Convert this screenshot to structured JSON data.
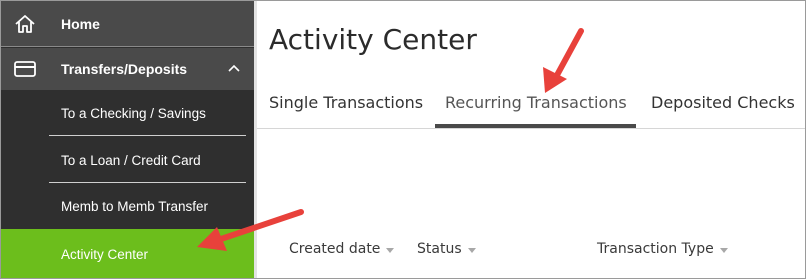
{
  "sidebar": {
    "home": {
      "label": "Home",
      "icon": "home-icon"
    },
    "transfers": {
      "label": "Transfers/Deposits",
      "icon": "card-icon",
      "expand_icon": "chevron-up-icon"
    },
    "sub_items": [
      {
        "label": "To a Checking / Savings"
      },
      {
        "label": "To a Loan / Credit Card"
      },
      {
        "label": "Memb to Memb Transfer"
      },
      {
        "label": "Activity Center",
        "active": true
      }
    ]
  },
  "main": {
    "title": "Activity Center",
    "tabs": [
      {
        "label": "Single Transactions"
      },
      {
        "label": "Recurring Transactions",
        "selected": true
      },
      {
        "label": "Deposited Checks"
      }
    ],
    "columns": [
      {
        "label": "Created date"
      },
      {
        "label": "Status"
      },
      {
        "label": "Transaction Type"
      }
    ]
  },
  "colors": {
    "sidebar_bg": "#2f2f2f",
    "active_item": "#6cbe1c",
    "annotation_arrow": "#e8413b"
  }
}
